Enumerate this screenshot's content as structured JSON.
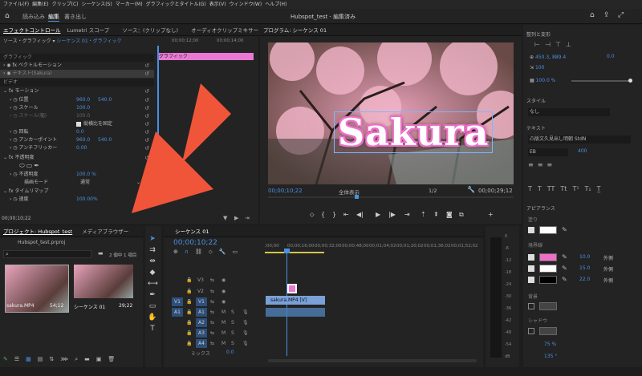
{
  "menu": [
    "ファイル(F)",
    "編集(E)",
    "クリップ(C)",
    "シーケンス(S)",
    "マーカー(M)",
    "グラフィックとタイトル(G)",
    "表示(V)",
    "ウィンドウ(W)",
    "ヘルプ(H)"
  ],
  "workspace": {
    "tab1": "読み込み",
    "tab2": "編集",
    "tab3": "書き出し",
    "title": "Hubspot_test - 編集済み"
  },
  "effect_controls": {
    "tabs": [
      "エフェクトコントロール",
      "Lumetri スコープ",
      "ソース：(クリップなし)",
      "オーディオクリップミキサー："
    ],
    "source_line": "ソース・グラフィック",
    "sequence_line": "シーケンス 01・グラフィック",
    "clip_label": "グラフィック",
    "section_graphic": "グラフィック",
    "vector_motion": "ベクトルモーション",
    "text_layer": "テキスト(Sakura)",
    "section_video": "ビデオ",
    "motion": "モーション",
    "position_label": "位置",
    "position_x": "960.0",
    "position_y": "540.0",
    "scale_label": "スケール",
    "scale_value": "100.0",
    "scale_width_label": "スケール(幅)",
    "scale_width_value": "100.0",
    "uniform_label": "縦横比を固定",
    "rotation_label": "回転",
    "rotation_value": "0.0",
    "anchor_label": "アンカーポイント",
    "anchor_x": "960.0",
    "anchor_y": "540.0",
    "antiflicker_label": "アンチフリッカー",
    "antiflicker_value": "0.00",
    "opacity_section": "不透明度",
    "opacity_label": "不透明度",
    "opacity_value": "100.0 %",
    "blend_label": "描画モード",
    "blend_value": "通常",
    "timeremap_section": "タイムリマップ",
    "speed_label": "速度",
    "speed_value": "100.00%",
    "timecode": "00;00;10;22",
    "ruler": [
      "00;00;12;00",
      "00;00;14;00"
    ]
  },
  "program": {
    "title": "プログラム: シーケンス 01",
    "overlay_text": "Sakura",
    "timecode": "00;00;10;22",
    "fit": "全体表示",
    "quality": "1/2",
    "duration": "00;00;29;12"
  },
  "project": {
    "tabs": [
      "プロジェクト: Hubspot_test",
      "メディアブラウザー"
    ],
    "file": "Hubspot_test.prproj",
    "count": "2 個中 1 項目",
    "items": [
      {
        "name": "sakura.MP4",
        "duration": "54;12"
      },
      {
        "name": "シーケンス 01",
        "duration": "29;22"
      }
    ]
  },
  "timeline": {
    "tab": "シーケンス 01",
    "timecode": "00;00;10;22",
    "ruler": [
      ";00;00",
      "00;00;16;00",
      "00;00;32;00",
      "00;00;48;00",
      "00;01;04;02",
      "00;01;20;02",
      "00;01;36;02",
      "00;01;52;02"
    ],
    "video_tracks": [
      "V3",
      "V2",
      "V1"
    ],
    "audio_tracks": [
      "A1",
      "A2",
      "A3",
      "A4"
    ],
    "source_v": "V1",
    "source_a": "A1",
    "clip_label": "sakura.MP4 [V]",
    "mix_label": "ミックス",
    "mix_value": "0.0"
  },
  "meters": {
    "labels": [
      "0",
      "-6",
      "-12",
      "-18",
      "-24",
      "-30",
      "-36",
      "-42",
      "-48",
      "-54",
      "dB"
    ]
  },
  "essential_graphics": {
    "align_header": "整列と変形",
    "position_x": "450.3",
    "position_y": "889.4",
    "rotation": "0.0",
    "scale": "100",
    "opacity": "100.0 %",
    "style_header": "スタイル",
    "style_value": "なし",
    "text_header": "テキスト",
    "font": "凸版文久見出し明朝 StdN",
    "font_style": "EB",
    "font_size": "400",
    "appearance_header": "アピアランス",
    "fill_label": "塗り",
    "stroke_label": "境界線",
    "strokes": [
      {
        "color": "#ee6fc8",
        "width": "10.0",
        "type": "外側"
      },
      {
        "color": "#ffffff",
        "width": "15.0",
        "type": "外側"
      },
      {
        "color": "#000000",
        "width": "22.0",
        "type": "外側"
      }
    ],
    "bg_label": "背景",
    "shadow_label": "シャドウ",
    "shadow_opacity": "75 %",
    "shadow_angle": "135 °"
  },
  "colors": {
    "accent": "#4a90e2",
    "graphic_clip": "#e978d2",
    "video_clip": "#7aa0d8",
    "arrow": "#f0553a"
  }
}
